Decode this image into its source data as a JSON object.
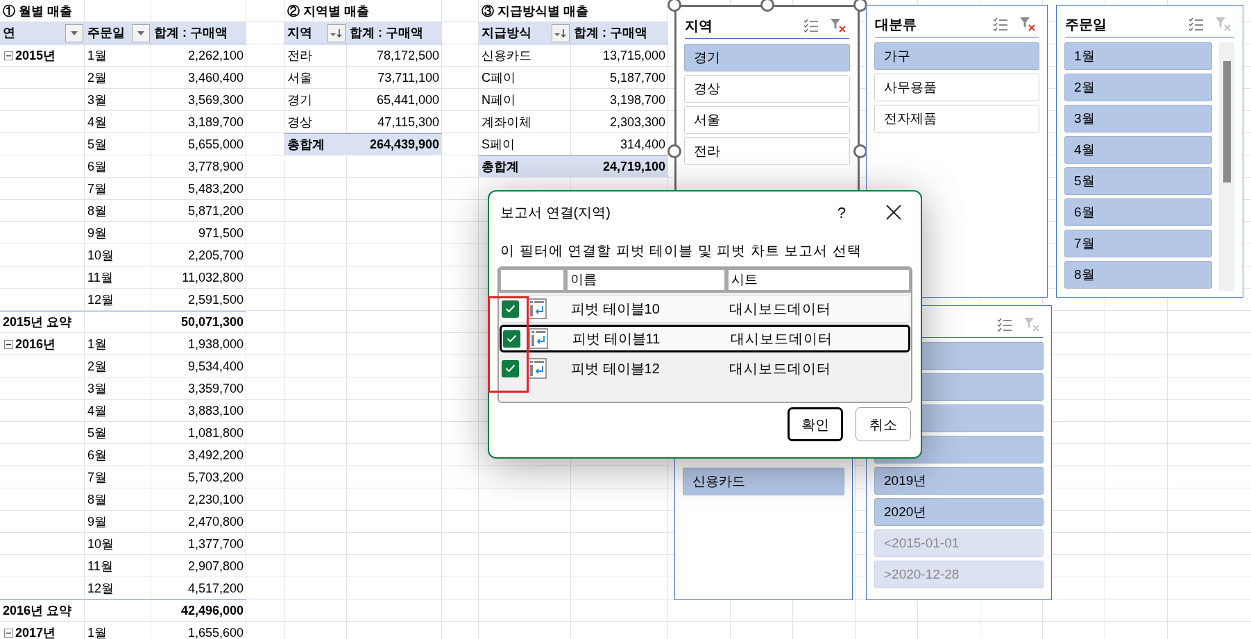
{
  "sheet": {
    "pivot_tables": [
      {
        "kind": "grouped",
        "title": "① 월별 매출",
        "columns": [
          {
            "label": "연",
            "kind": "filter"
          },
          {
            "label": "주문일",
            "kind": "filter"
          },
          {
            "label": "합계 : 구매액",
            "kind": "plain"
          }
        ],
        "groups": [
          {
            "label": "2015년",
            "expanded": true,
            "rows": [
              {
                "label": "1월",
                "value": "2,262,100"
              },
              {
                "label": "2월",
                "value": "3,460,400"
              },
              {
                "label": "3월",
                "value": "3,569,300"
              },
              {
                "label": "4월",
                "value": "3,189,700"
              },
              {
                "label": "5월",
                "value": "5,655,000"
              },
              {
                "label": "6월",
                "value": "3,778,900"
              },
              {
                "label": "7월",
                "value": "5,483,200"
              },
              {
                "label": "8월",
                "value": "5,871,200"
              },
              {
                "label": "9월",
                "value": "971,500"
              },
              {
                "label": "10월",
                "value": "2,205,700"
              },
              {
                "label": "11월",
                "value": "11,032,800"
              },
              {
                "label": "12월",
                "value": "2,591,500"
              }
            ],
            "subtotal": {
              "label": "2015년 요약",
              "value": "50,071,300"
            }
          },
          {
            "label": "2016년",
            "expanded": true,
            "rows": [
              {
                "label": "1월",
                "value": "1,938,000"
              },
              {
                "label": "2월",
                "value": "9,534,400"
              },
              {
                "label": "3월",
                "value": "3,359,700"
              },
              {
                "label": "4월",
                "value": "3,883,100"
              },
              {
                "label": "5월",
                "value": "1,081,800"
              },
              {
                "label": "6월",
                "value": "3,492,200"
              },
              {
                "label": "7월",
                "value": "5,703,200"
              },
              {
                "label": "8월",
                "value": "2,230,100"
              },
              {
                "label": "9월",
                "value": "2,470,800"
              },
              {
                "label": "10월",
                "value": "1,377,700"
              },
              {
                "label": "11월",
                "value": "2,907,800"
              },
              {
                "label": "12월",
                "value": "4,517,200"
              }
            ],
            "subtotal": {
              "label": "2016년 요약",
              "value": "42,496,000"
            }
          },
          {
            "label": "2017년",
            "expanded": true,
            "rows": [
              {
                "label": "1월",
                "value": "1,655,600"
              }
            ]
          }
        ]
      },
      {
        "kind": "flat",
        "title": "② 지역별 매출",
        "columns": [
          {
            "label": "지역",
            "kind": "sort"
          },
          {
            "label": "합계 : 구매액",
            "kind": "plain"
          }
        ],
        "rows": [
          {
            "label": "전라",
            "value": "78,172,500"
          },
          {
            "label": "서울",
            "value": "73,711,100"
          },
          {
            "label": "경기",
            "value": "65,441,000"
          },
          {
            "label": "경상",
            "value": "47,115,300"
          }
        ],
        "total": {
          "label": "총합계",
          "value": "264,439,900"
        }
      },
      {
        "kind": "flat",
        "title": "③ 지급방식별 매출",
        "columns": [
          {
            "label": "지급방식",
            "kind": "sort"
          },
          {
            "label": "합계 : 구매액",
            "kind": "plain"
          }
        ],
        "rows": [
          {
            "label": "신용카드",
            "value": "13,715,000"
          },
          {
            "label": "C페이",
            "value": "5,187,700"
          },
          {
            "label": "N페이",
            "value": "3,198,700"
          },
          {
            "label": "계좌이체",
            "value": "2,303,300"
          },
          {
            "label": "S페이",
            "value": "314,400"
          }
        ],
        "total": {
          "label": "총합계",
          "value": "24,719,100"
        }
      }
    ]
  },
  "slicers": [
    {
      "title": "지역",
      "selected": true,
      "filtered": true,
      "scrollable": false,
      "items": [
        {
          "label": "경기",
          "selected": true
        },
        {
          "label": "경상",
          "selected": false
        },
        {
          "label": "서울",
          "selected": false
        },
        {
          "label": "전라",
          "selected": false
        }
      ]
    },
    {
      "title": "대분류",
      "selected": false,
      "filtered": true,
      "scrollable": false,
      "items": [
        {
          "label": "가구",
          "selected": true
        },
        {
          "label": "사무용품",
          "selected": false
        },
        {
          "label": "전자제품",
          "selected": false
        }
      ]
    },
    {
      "title": "주문일",
      "selected": false,
      "filtered": false,
      "scrollable": true,
      "items": [
        {
          "label": "1월",
          "selected": true
        },
        {
          "label": "2월",
          "selected": true
        },
        {
          "label": "3월",
          "selected": true
        },
        {
          "label": "4월",
          "selected": true
        },
        {
          "label": "5월",
          "selected": true
        },
        {
          "label": "6월",
          "selected": true
        },
        {
          "label": "7월",
          "selected": true
        },
        {
          "label": "8월",
          "selected": true
        }
      ]
    },
    {
      "selected": false,
      "scrollable": false,
      "items": [
        {
          "label": "신용카드",
          "selected": true
        }
      ]
    },
    {
      "selected": false,
      "filtered": false,
      "scrollable": false,
      "items": [
        {
          "selected": true,
          "has_data": true
        },
        {
          "selected": true,
          "has_data": true
        },
        {
          "selected": true,
          "has_data": true
        },
        {
          "selected": true,
          "has_data": true
        },
        {
          "label": "2019년",
          "selected": true,
          "has_data": true
        },
        {
          "label": "2020년",
          "selected": true,
          "has_data": true
        },
        {
          "label": "<2015-01-01",
          "selected": true,
          "has_data": false
        },
        {
          "label": ">2020-12-28",
          "selected": true,
          "has_data": false
        }
      ]
    }
  ],
  "dialog": {
    "title": "보고서 연결(지역)",
    "help": "?",
    "instruction": "이 필터에 연결할 피벗 테이블 및 피벗 차트 보고서 선택",
    "columns": [
      "이름",
      "시트"
    ],
    "rows": [
      {
        "checked": true,
        "name": "피벗 테이블10",
        "sheet": "대시보드데이터",
        "focused": false
      },
      {
        "checked": true,
        "name": "피벗 테이블11",
        "sheet": "대시보드데이터",
        "focused": true
      },
      {
        "checked": true,
        "name": "피벗 테이블12",
        "sheet": "대시보드데이터",
        "focused": false
      }
    ],
    "buttons": [
      {
        "label": "확인",
        "default": true
      },
      {
        "label": "취소",
        "default": false
      }
    ]
  }
}
